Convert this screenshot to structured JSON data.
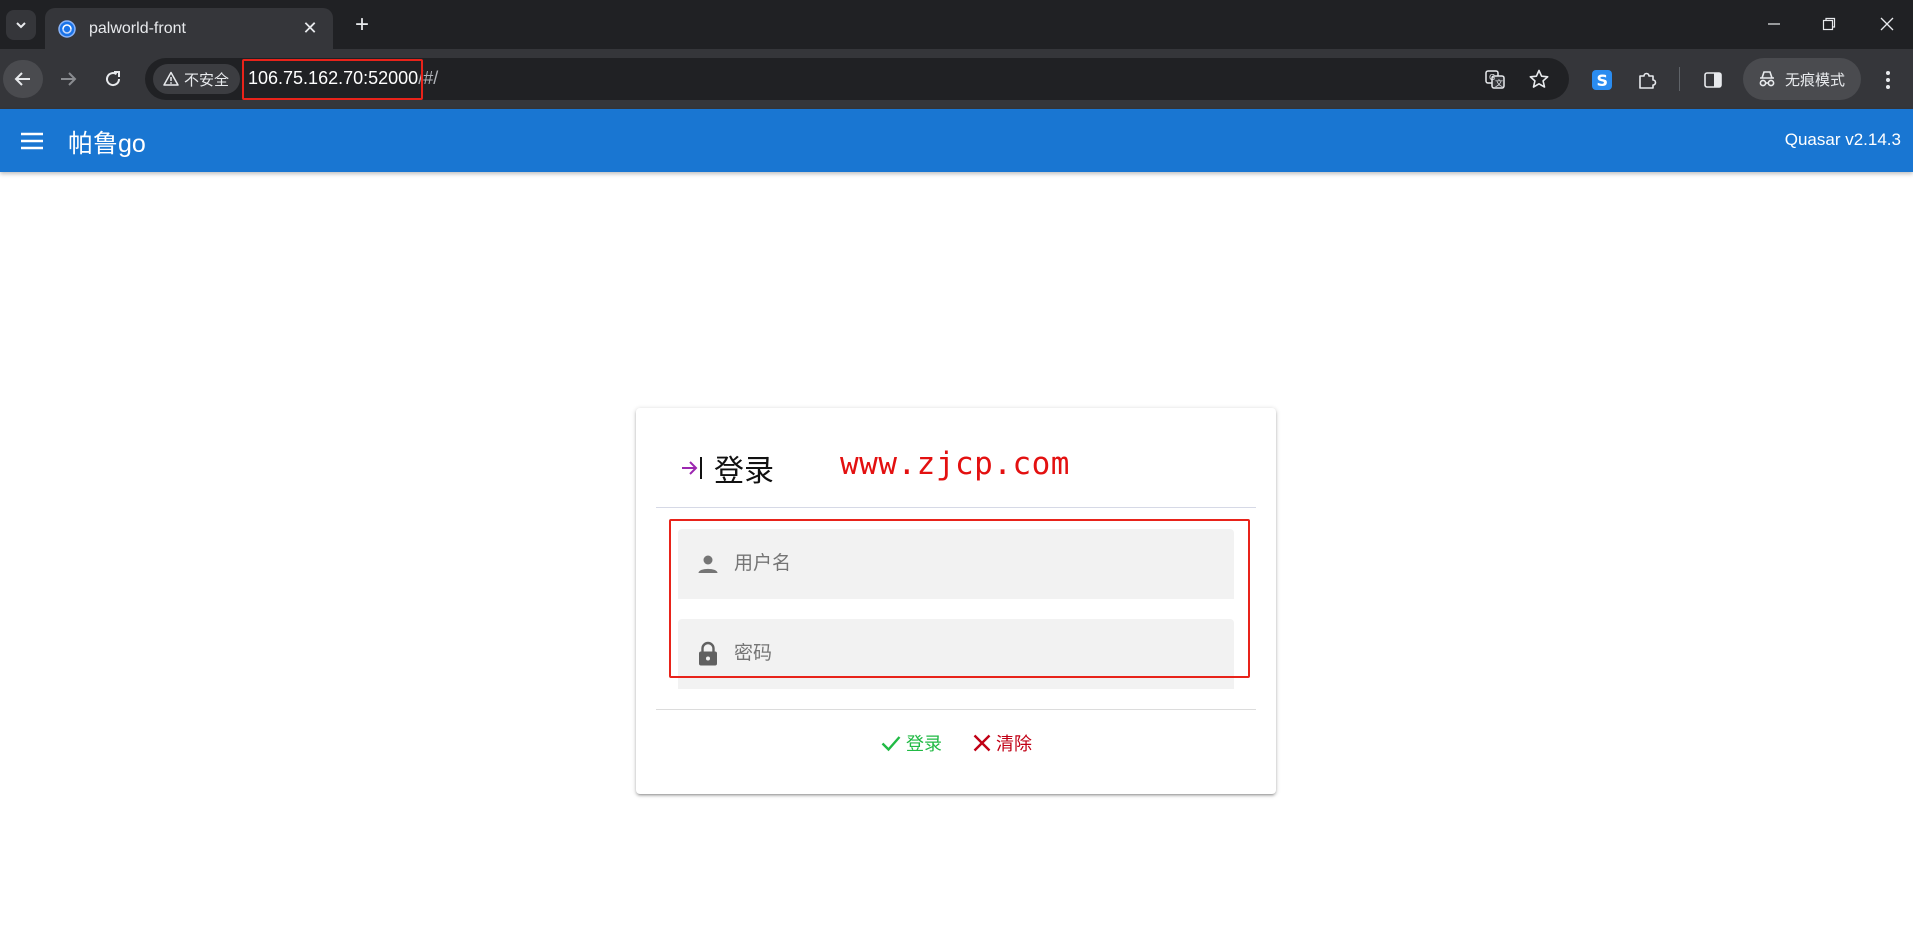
{
  "browser": {
    "tab": {
      "title": "palworld-front",
      "favicon": "palworld-favicon-icon"
    },
    "security_label": "不安全",
    "url": {
      "host": "106.75.162.70",
      "port": ":52000",
      "path": "/#/"
    },
    "incognito_label": "无痕模式"
  },
  "header": {
    "title": "帕鲁go",
    "version": "Quasar v2.14.3"
  },
  "login": {
    "title": "登录",
    "watermark": "www.zjcp.com",
    "username_placeholder": "用户名",
    "password_placeholder": "密码",
    "login_button": "登录",
    "clear_button": "清除"
  },
  "colors": {
    "header": "#1976d2",
    "positive": "#21ba45",
    "negative": "#c10015",
    "highlight": "#e8231a"
  }
}
